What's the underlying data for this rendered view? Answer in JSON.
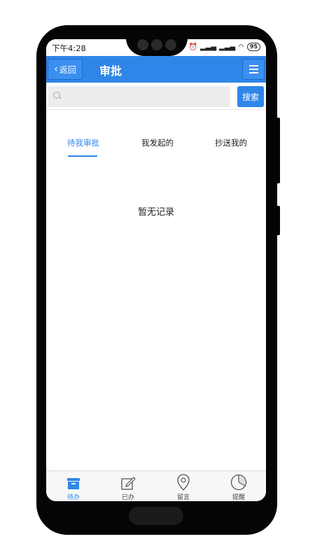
{
  "status_bar": {
    "time": "下午4:28",
    "battery": "95"
  },
  "header": {
    "back_label": "返回",
    "title": "审批"
  },
  "search": {
    "placeholder": "",
    "button_label": "搜索"
  },
  "tabs": [
    {
      "label": "待我审批",
      "active": true
    },
    {
      "label": "我发起的",
      "active": false
    },
    {
      "label": "抄送我的",
      "active": false
    }
  ],
  "empty_message": "暂无记录",
  "bottom_nav": [
    {
      "label": "待办",
      "icon": "inbox-icon",
      "active": true
    },
    {
      "label": "已办",
      "icon": "edit-icon",
      "active": false
    },
    {
      "label": "留言",
      "icon": "location-pin-icon",
      "active": false
    },
    {
      "label": "提醒",
      "icon": "pie-chart-icon",
      "active": false
    }
  ],
  "colors": {
    "accent": "#2f86e8"
  }
}
